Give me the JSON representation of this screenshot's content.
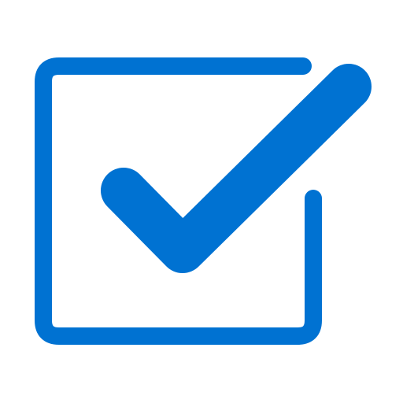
{
  "icon": {
    "name": "checkbox-checked-icon",
    "accent_color": "#0072D2",
    "background_color": "#FFFFFF",
    "state": "checked"
  }
}
